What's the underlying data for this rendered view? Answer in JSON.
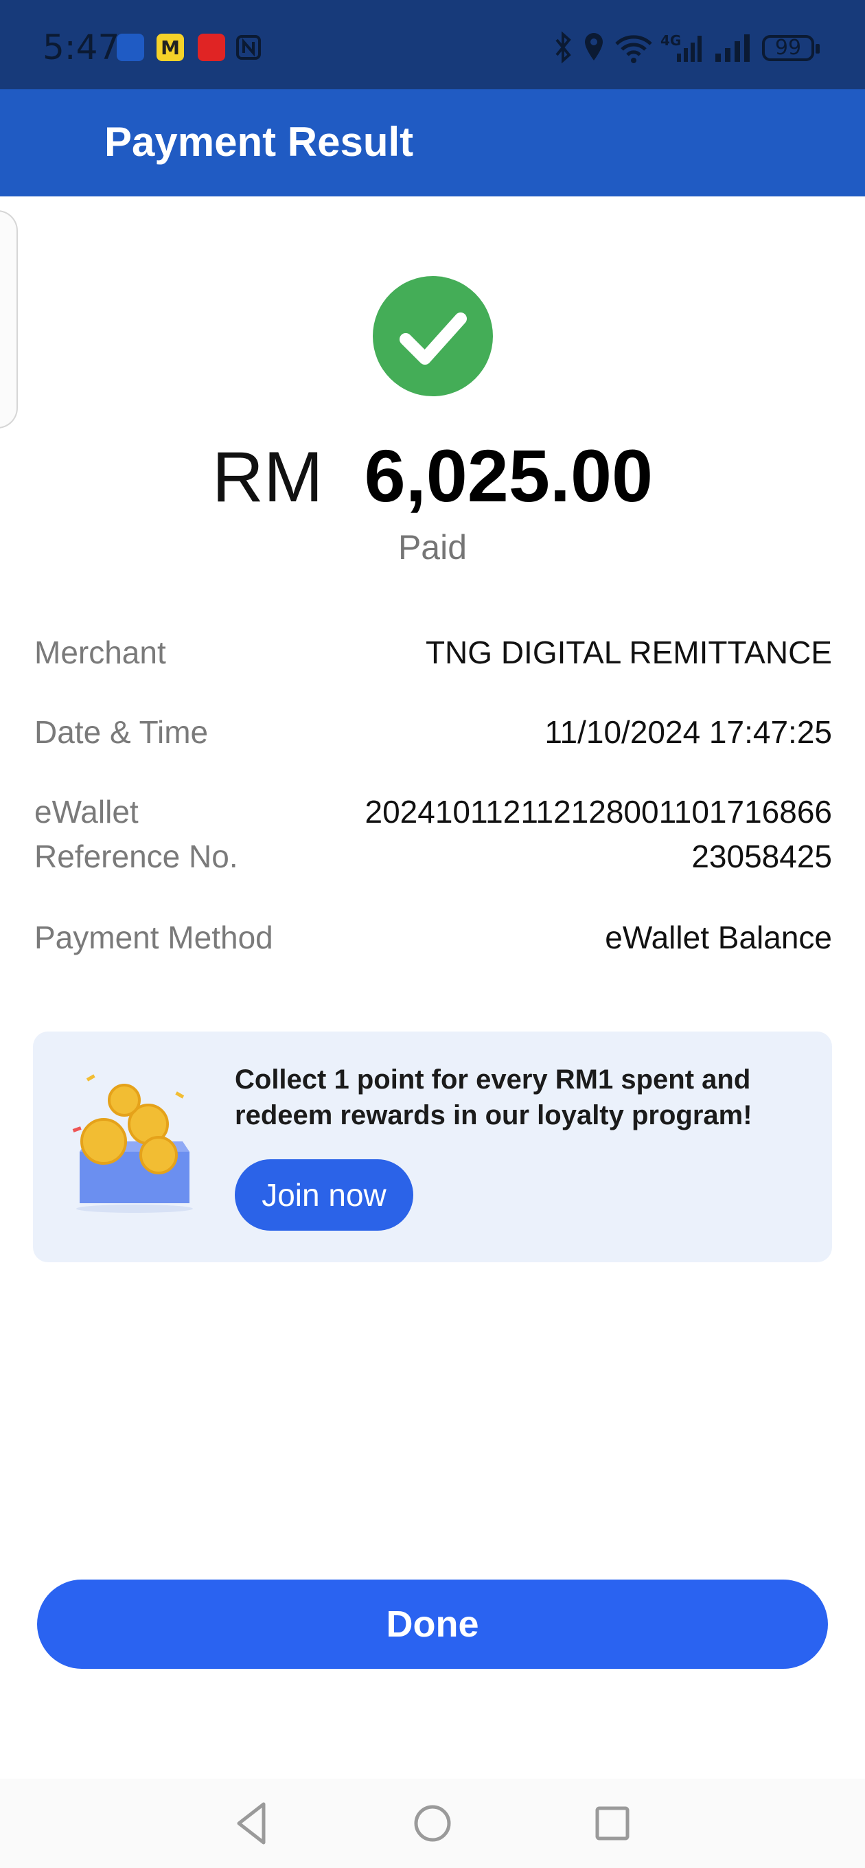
{
  "status_bar": {
    "time": "5:47",
    "battery": "99",
    "app_icons": [
      "touch-n-go-app-icon",
      "m-app-icon",
      "red-app-icon",
      "nfc-icon"
    ],
    "right_icons": [
      "bluetooth-icon",
      "location-icon",
      "wifi-icon",
      "signal-4g-icon",
      "signal-icon"
    ]
  },
  "header": {
    "title": "Payment Result"
  },
  "result": {
    "status_icon": "check-icon",
    "status_color": "#44ad57",
    "currency": "RM",
    "amount": "6,025.00",
    "status_text": "Paid"
  },
  "details": [
    {
      "label": "Merchant",
      "value": "TNG DIGITAL REMITTANCE"
    },
    {
      "label": "Date & Time",
      "value": "11/10/2024 17:47:25"
    },
    {
      "label_line1": "eWallet",
      "label_line2": "Reference No.",
      "value_line1": "2024101121121280011017168​66",
      "value_line2": "23058425"
    },
    {
      "label": "Payment Method",
      "value": "eWallet Balance"
    }
  ],
  "promo": {
    "text": "Collect 1 point for every RM1 spent and redeem rewards in our loyalty program!",
    "button_label": "Join now",
    "art_icon": "gift-coins-box-icon"
  },
  "done_button": "Done",
  "nav": [
    "back-icon",
    "home-icon",
    "recents-icon"
  ],
  "colors": {
    "status_bar": "#173a7a",
    "app_bar": "#205bc3",
    "primary_button": "#2a63f1",
    "promo_bg": "#ebf1fb"
  }
}
